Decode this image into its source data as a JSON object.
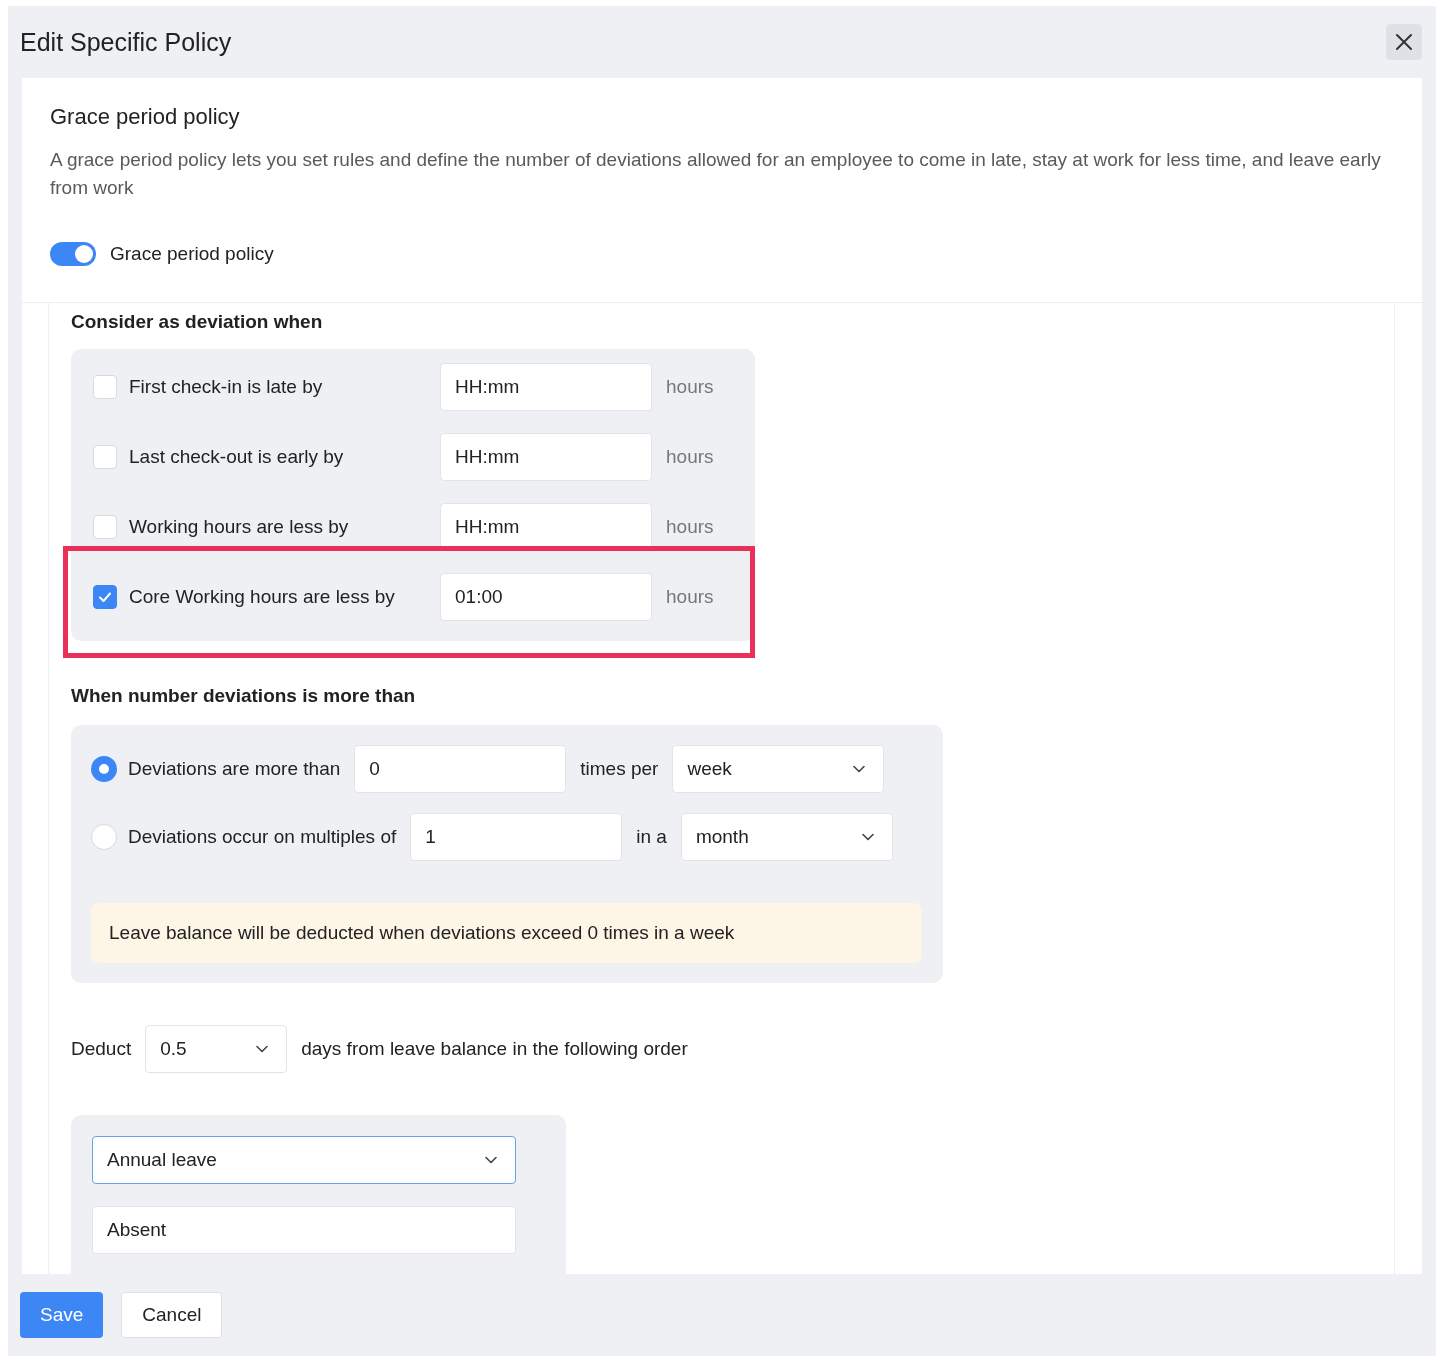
{
  "dialog": {
    "title": "Edit Specific Policy"
  },
  "section": {
    "title": "Grace period policy",
    "description": "A grace period policy lets you set rules and define the number of deviations allowed for an employee to come in late, stay at work for less time, and leave early from work",
    "toggle": {
      "label": "Grace period policy",
      "on": true
    }
  },
  "conditions": {
    "heading": "Consider as deviation when",
    "rows": [
      {
        "label": "First check-in is late by",
        "checked": false,
        "placeholder": "HH:mm",
        "unit": "hours",
        "highlighted": false
      },
      {
        "label": "Last check-out is early by",
        "checked": false,
        "placeholder": "HH:mm",
        "unit": "hours",
        "highlighted": false
      },
      {
        "label": "Working hours are less by",
        "checked": false,
        "placeholder": "HH:mm",
        "unit": "hours",
        "highlighted": false
      },
      {
        "label": "Core Working hours are less by",
        "checked": true,
        "value": "01:00",
        "unit": "hours",
        "highlighted": true
      }
    ]
  },
  "frequency": {
    "heading": "When number deviations is more than",
    "options": [
      {
        "label": "Deviations are more than",
        "selected": true,
        "value": "0",
        "connector": "times per",
        "period": "week"
      },
      {
        "label": "Deviations occur on multiples of",
        "selected": false,
        "value": "1",
        "connector": "in a",
        "period": "month"
      }
    ],
    "note": "Leave balance will be deducted when deviations exceed 0 times in a week"
  },
  "deduct": {
    "label": "Deduct",
    "value": "0.5",
    "suffix": "days from leave balance in the following order"
  },
  "leave_order": [
    {
      "kind": "select",
      "value": "Annual leave"
    },
    {
      "kind": "field",
      "value": "Absent"
    }
  ],
  "buttons": [
    {
      "kind": "primary",
      "label": "Save"
    },
    {
      "kind": "secondary",
      "label": "Cancel"
    }
  ]
}
